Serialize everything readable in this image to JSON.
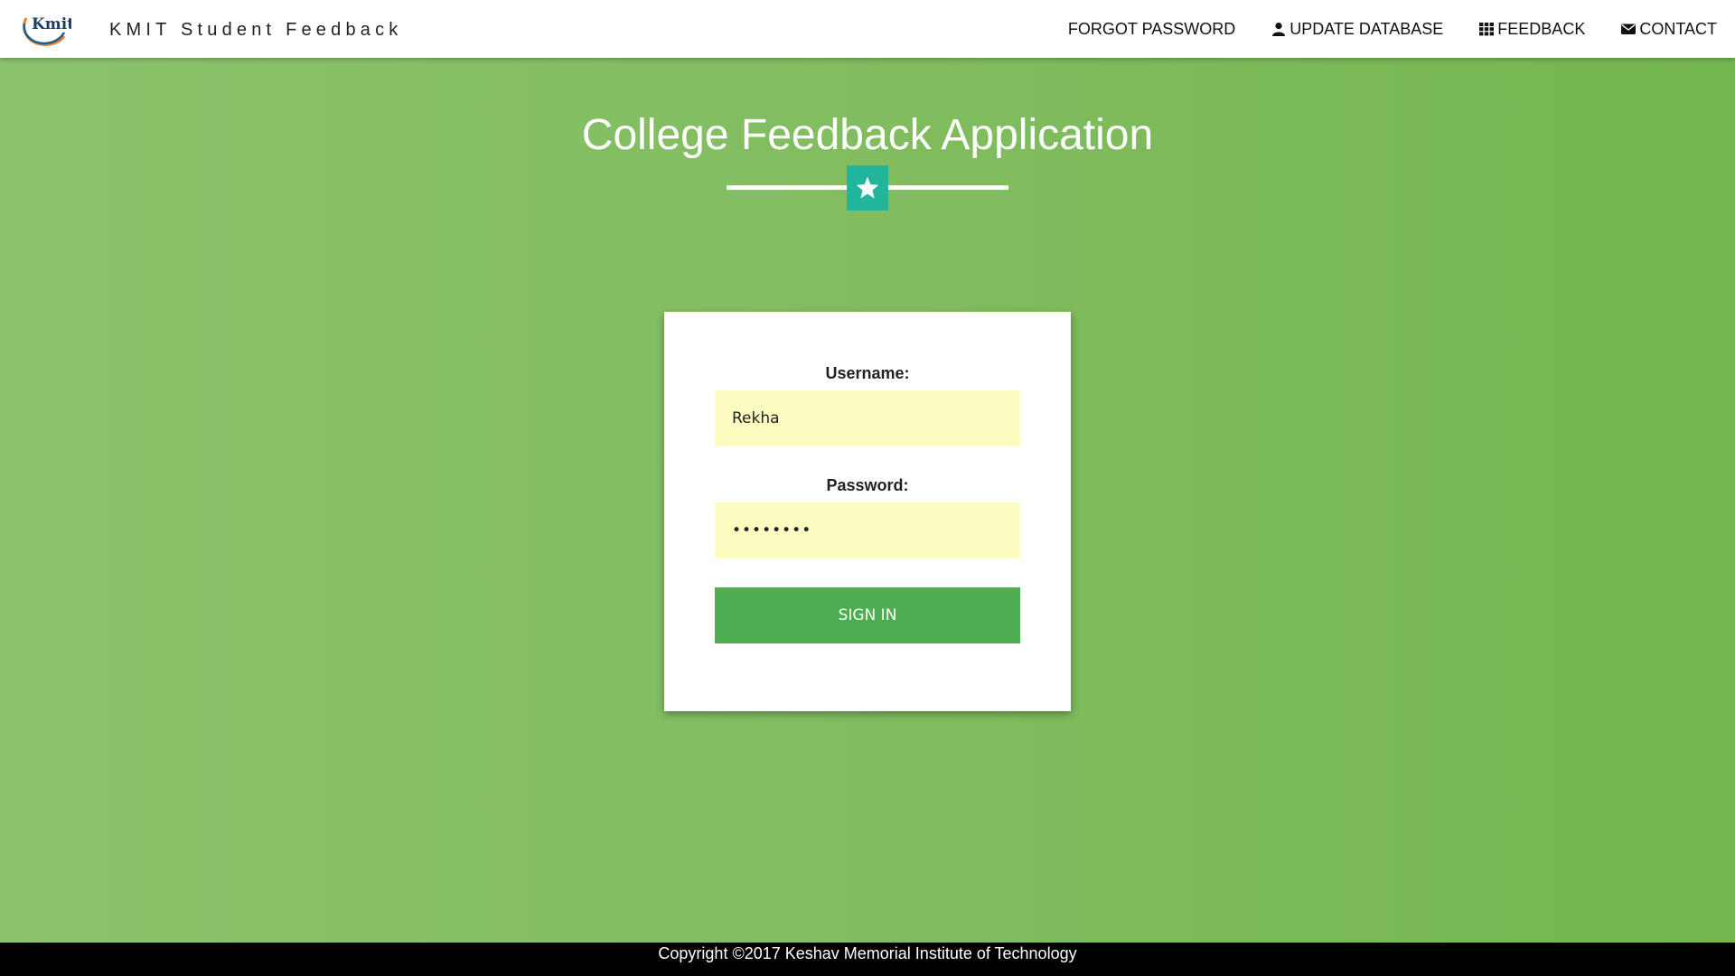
{
  "navbar": {
    "logo_text": "Kmit",
    "brand_title": "KMIT Student Feedback",
    "links": [
      {
        "label": "FORGOT PASSWORD",
        "icon": ""
      },
      {
        "label": "UPDATE DATABASE",
        "icon": "user-icon"
      },
      {
        "label": "FEEDBACK",
        "icon": "grid-icon"
      },
      {
        "label": "CONTACT",
        "icon": "envelope-icon"
      }
    ]
  },
  "header": {
    "title": "College Feedback Application",
    "divider_icon": "star-icon"
  },
  "login": {
    "username_label": "Username:",
    "username_value": "Rekha",
    "password_label": "Password:",
    "password_value": "12345678",
    "signin_label": "SIGN IN"
  },
  "colors": {
    "background_green": "#80bc5e",
    "star_box": "#21b59b",
    "input_bg": "#fafcc0",
    "button_green": "#4cae50",
    "footer_bg": "#000000"
  },
  "footer": {
    "copyright": "Copyright ©2017 Keshav Memorial Institute of Technology"
  }
}
